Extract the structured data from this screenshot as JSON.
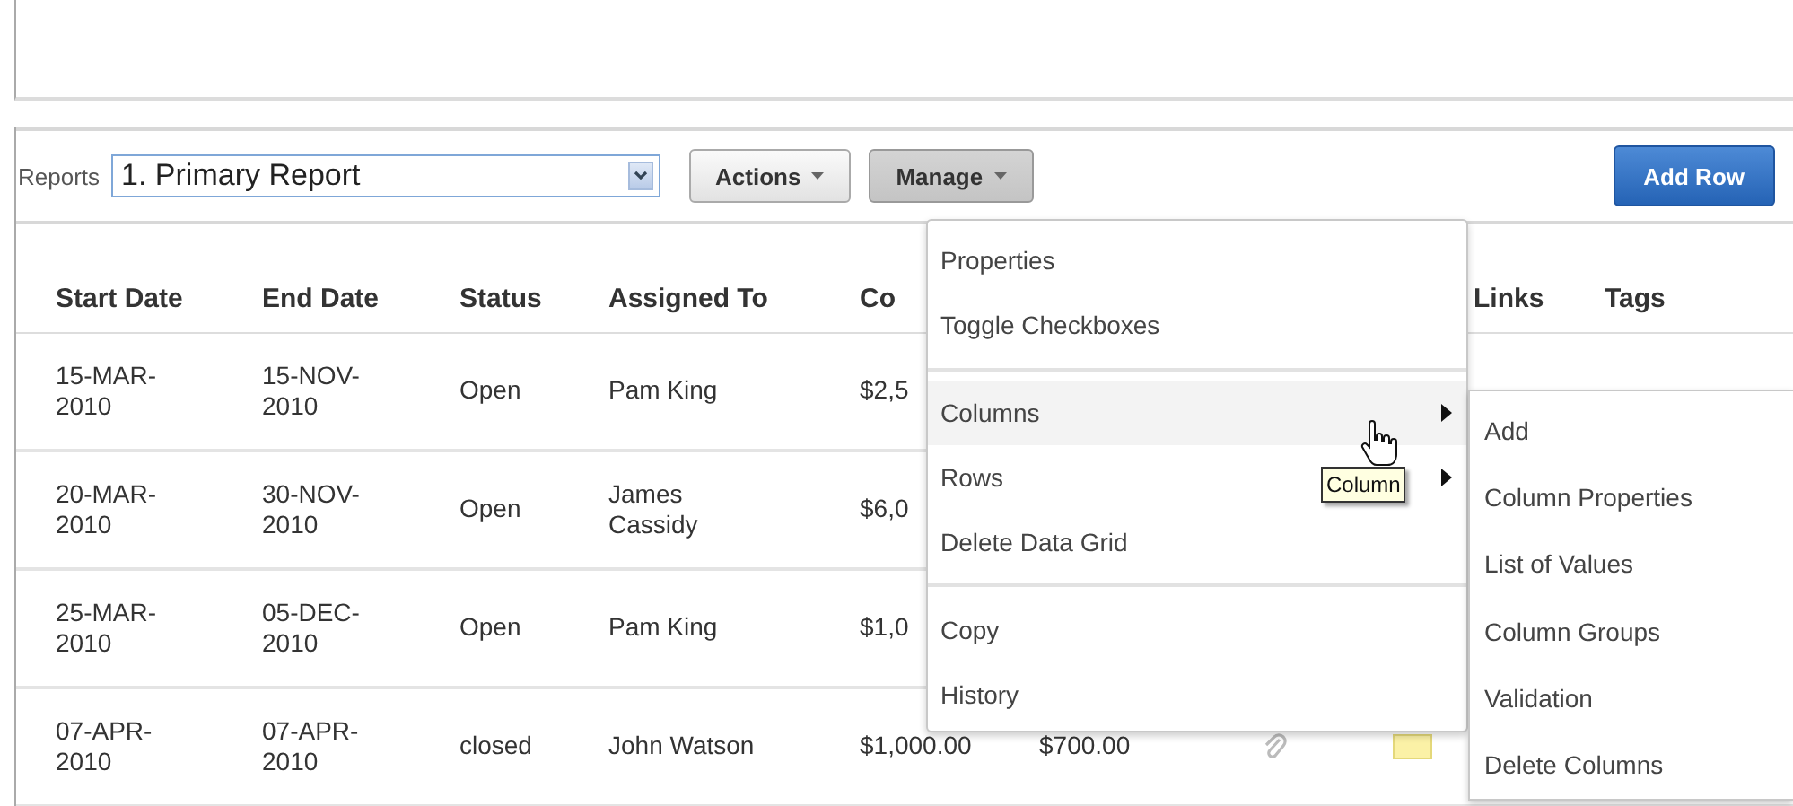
{
  "toolbar": {
    "reports_label": "Reports",
    "report_select": {
      "value": "1. Primary Report"
    },
    "buttons": [
      {
        "label": "Actions",
        "kind": "menu",
        "pressed": false
      },
      {
        "label": "Manage",
        "kind": "menu",
        "pressed": true
      },
      {
        "label": "Add Row",
        "kind": "primary"
      }
    ]
  },
  "table": {
    "columns": [
      {
        "label": "Start Date"
      },
      {
        "label": "End Date"
      },
      {
        "label": "Status"
      },
      {
        "label": "Assigned To"
      },
      {
        "label": "Co"
      },
      {},
      {},
      {},
      {
        "label": "Links"
      },
      {
        "label": "Tags"
      }
    ],
    "rows": [
      {
        "start_date": "15-MAR-2010",
        "end_date": "15-NOV-2010",
        "status": "Open",
        "assigned_to": "Pam King",
        "column_5": "$2,5"
      },
      {
        "start_date": "20-MAR-2010",
        "end_date": "30-NOV-2010",
        "status": "Open",
        "assigned_to": "James Cassidy",
        "column_5": "$6,0"
      },
      {
        "start_date": "25-MAR-2010",
        "end_date": "05-DEC-2010",
        "status": "Open",
        "assigned_to": "Pam King",
        "column_5": "$1,0"
      },
      {
        "start_date": "07-APR-2010",
        "end_date": "07-APR-2010",
        "status": "closed",
        "assigned_to": "John Watson",
        "column_5": "$1,000.00",
        "column_6": "$700.00",
        "attachment": true,
        "note": true
      }
    ]
  },
  "manage_menu": {
    "items": [
      {
        "kind": "item",
        "label": "Properties",
        "selected": false,
        "submenu": false
      },
      {
        "kind": "item",
        "label": "Toggle Checkboxes",
        "selected": false,
        "submenu": false
      },
      {
        "kind": "separator"
      },
      {
        "kind": "item",
        "label": "Columns",
        "selected": true,
        "submenu": true
      },
      {
        "kind": "item",
        "label": "Rows",
        "selected": false,
        "submenu": true
      },
      {
        "kind": "item",
        "label": "Delete Data Grid",
        "selected": false,
        "submenu": false
      },
      {
        "kind": "separator"
      },
      {
        "kind": "item",
        "label": "Copy",
        "selected": false,
        "submenu": false
      },
      {
        "kind": "item",
        "label": "History",
        "selected": false,
        "submenu": false
      }
    ]
  },
  "columns_submenu": {
    "items": [
      "Add",
      "Column Properties",
      "List of Values",
      "Column Groups",
      "Validation",
      "Delete Columns"
    ]
  },
  "tooltip": {
    "text": "Column"
  }
}
